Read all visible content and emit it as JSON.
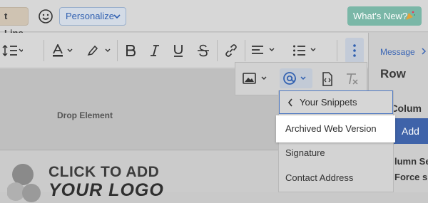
{
  "topbar": {
    "subject_line_label": "t Line",
    "personalize_label": "Personalize",
    "whats_new_label": "What's New?"
  },
  "panel": {
    "breadcrumb": "Message",
    "title": "Row",
    "column_label": "d Colum",
    "add_label": "Add",
    "column_sep_label": "lumn Se",
    "force_label": "Force s"
  },
  "canvas": {
    "drop_label": "Drop Element",
    "logo_line1": "CLICK TO ADD",
    "logo_line2": "YOUR LOGO"
  },
  "snippets": {
    "header": "Your Snippets",
    "items": [
      "Archived Web Version",
      "Signature",
      "Contact Address"
    ]
  },
  "icons": {
    "toolbar": [
      "line-height-icon",
      "font-color-icon",
      "highlighter-icon",
      "bold-icon",
      "italic-icon",
      "underline-icon",
      "strikethrough-icon",
      "link-icon",
      "align-left-icon",
      "bulleted-list-icon",
      "more-vertical-icon"
    ],
    "subtoolbar": [
      "image-icon",
      "at-mention-icon",
      "code-file-icon",
      "clear-format-icon"
    ]
  },
  "colors": {
    "accent_blue": "#3f63a9",
    "link_blue": "#3b66b5",
    "whats_new_green": "#7ab7a7",
    "highlight_white": "#ffffff"
  }
}
